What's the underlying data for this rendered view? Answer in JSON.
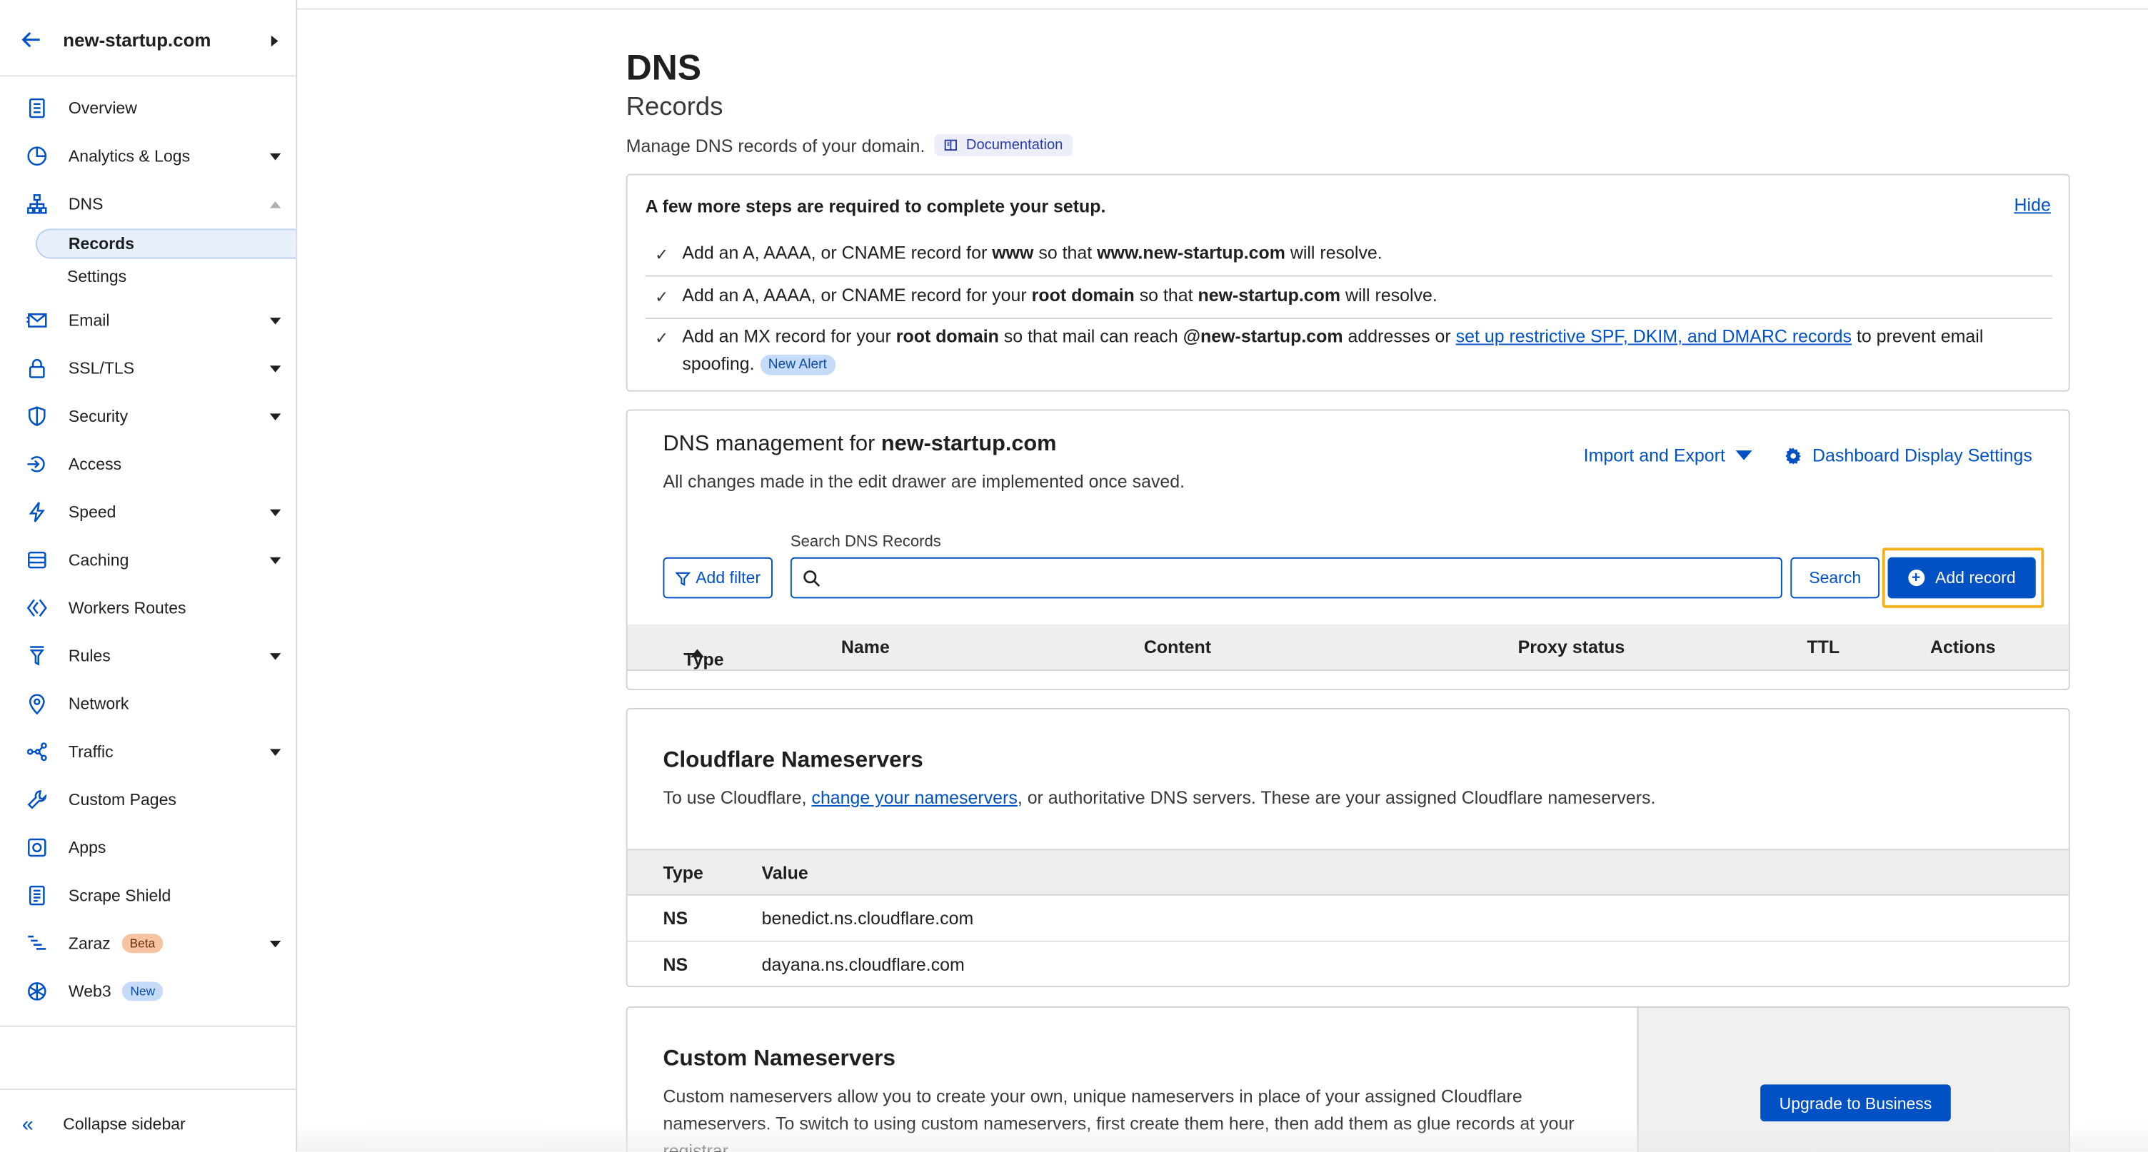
{
  "sidebar": {
    "domain": "new-startup.com",
    "items": [
      {
        "label": "Overview"
      },
      {
        "label": "Analytics & Logs"
      },
      {
        "label": "DNS"
      },
      {
        "label": "Email"
      },
      {
        "label": "SSL/TLS"
      },
      {
        "label": "Security"
      },
      {
        "label": "Access"
      },
      {
        "label": "Speed"
      },
      {
        "label": "Caching"
      },
      {
        "label": "Workers Routes"
      },
      {
        "label": "Rules"
      },
      {
        "label": "Network"
      },
      {
        "label": "Traffic"
      },
      {
        "label": "Custom Pages"
      },
      {
        "label": "Apps"
      },
      {
        "label": "Scrape Shield"
      },
      {
        "label": "Zaraz",
        "badge": "Beta"
      },
      {
        "label": "Web3",
        "badge": "New"
      }
    ],
    "dns_sub": [
      "Records",
      "Settings"
    ],
    "collapse_label": "Collapse sidebar"
  },
  "page": {
    "title": "DNS",
    "subtitle": "Records",
    "description": "Manage DNS records of your domain.",
    "doc_label": "Documentation"
  },
  "setup": {
    "title": "A few more steps are required to complete your setup.",
    "hide_label": "Hide",
    "step1": {
      "a": "Add an A, AAAA, or CNAME record for ",
      "b": "www",
      "c": " so that ",
      "d": "www.new-startup.com",
      "e": " will resolve."
    },
    "step2": {
      "a": "Add an A, AAAA, or CNAME record for your ",
      "b": "root domain",
      "c": " so that ",
      "d": "new-startup.com",
      "e": " will resolve."
    },
    "step3": {
      "a": "Add an MX record for your ",
      "b": "root domain",
      "c": " so that mail can reach ",
      "d": "@new-startup.com",
      "e": " addresses or ",
      "link": "set up restrictive SPF, DKIM, and DMARC records",
      "f": " to prevent email spoofing.",
      "badge": "New Alert"
    }
  },
  "management": {
    "title_prefix": "DNS management for ",
    "title_domain": "new-startup.com",
    "description": "All changes made in the edit drawer are implemented once saved.",
    "import_label": "Import and Export",
    "dashboard_label": "Dashboard Display Settings",
    "search_label": "Search DNS Records",
    "search_placeholder": "",
    "filter_label": "Add filter",
    "search_button": "Search",
    "add_label": "Add record",
    "columns": [
      "Type",
      "Name",
      "Content",
      "Proxy status",
      "TTL",
      "Actions"
    ]
  },
  "nameservers": {
    "title": "Cloudflare Nameservers",
    "desc_a": "To use Cloudflare, ",
    "desc_link": "change your nameservers",
    "desc_b": ", or authoritative DNS servers. These are your assigned Cloudflare nameservers.",
    "columns": [
      "Type",
      "Value"
    ],
    "rows": [
      {
        "type": "NS",
        "value": "benedict.ns.cloudflare.com"
      },
      {
        "type": "NS",
        "value": "dayana.ns.cloudflare.com"
      }
    ]
  },
  "custom": {
    "title": "Custom Nameservers",
    "description": "Custom nameservers allow you to create your own, unique nameservers in place of your assigned Cloudflare nameservers. To switch to using custom nameservers, first create them here, then add them as glue records at your registrar.",
    "upgrade_label": "Upgrade to Business"
  },
  "colors": {
    "accent": "#0051c3",
    "highlight": "#f2b21b"
  }
}
